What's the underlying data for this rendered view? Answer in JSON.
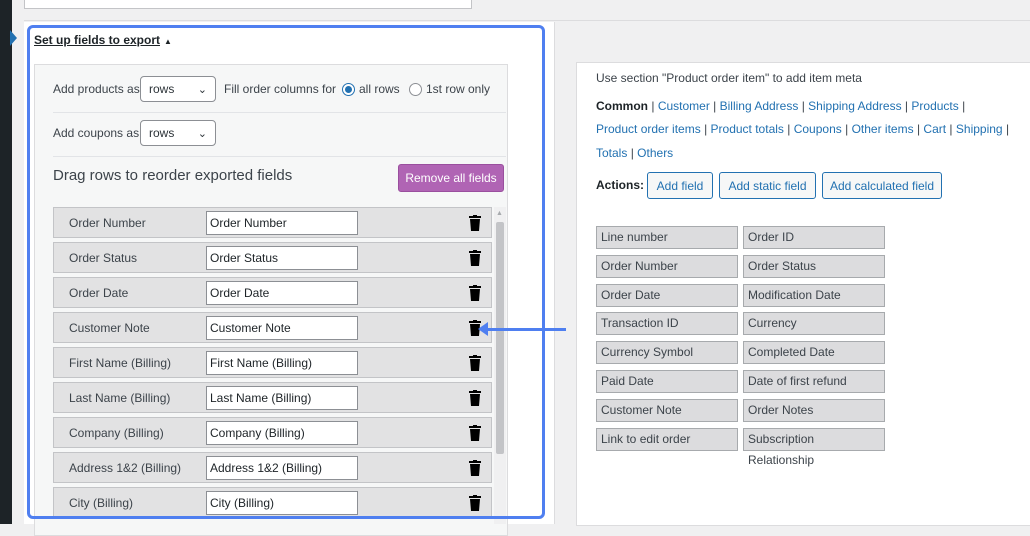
{
  "setup": {
    "title": "Set up fields to export"
  },
  "options": {
    "add_products_label": "Add products as",
    "add_products_value": "rows",
    "fill_order_label": "Fill order columns for",
    "radio_all": "all rows",
    "radio_first": "1st row only",
    "add_coupons_label": "Add coupons as",
    "add_coupons_value": "rows"
  },
  "drag": {
    "title": "Drag rows to reorder exported fields",
    "remove_all": "Remove all fields"
  },
  "fields": [
    {
      "name": "Order Number",
      "value": "Order Number"
    },
    {
      "name": "Order Status",
      "value": "Order Status"
    },
    {
      "name": "Order Date",
      "value": "Order Date"
    },
    {
      "name": "Customer Note",
      "value": "Customer Note"
    },
    {
      "name": "First Name (Billing)",
      "value": "First Name (Billing)"
    },
    {
      "name": "Last Name (Billing)",
      "value": "Last Name (Billing)"
    },
    {
      "name": "Company (Billing)",
      "value": "Company (Billing)"
    },
    {
      "name": "Address 1&2 (Billing)",
      "value": "Address 1&2 (Billing)"
    },
    {
      "name": "City (Billing)",
      "value": "City (Billing)"
    }
  ],
  "right": {
    "hint": "Use section \"Product order item\" to add item meta",
    "sections": {
      "common": "Common",
      "customer": "Customer",
      "billing": "Billing Address",
      "shipping_address": "Shipping Address",
      "products": "Products",
      "product_order_items": "Product order items",
      "product_totals": "Product totals",
      "coupons": "Coupons",
      "other_items": "Other items",
      "cart": "Cart",
      "shipping": "Shipping",
      "totals": "Totals",
      "others": "Others"
    },
    "actions_label": "Actions:",
    "add_field": "Add field",
    "add_static": "Add static field",
    "add_calculated": "Add calculated field",
    "cells": [
      "Line number",
      "Order ID",
      "Order Number",
      "Order Status",
      "Order Date",
      "Modification Date",
      "Transaction ID",
      "Currency",
      "Currency Symbol",
      "Completed Date",
      "Paid Date",
      "Date of first refund",
      "Customer Note",
      "Order Notes",
      "Link to edit order",
      "Subscription Relationship"
    ]
  },
  "colors": {
    "accent": "#2271b1",
    "highlight": "#4f7ff0",
    "remove_button": "#b064b4"
  }
}
